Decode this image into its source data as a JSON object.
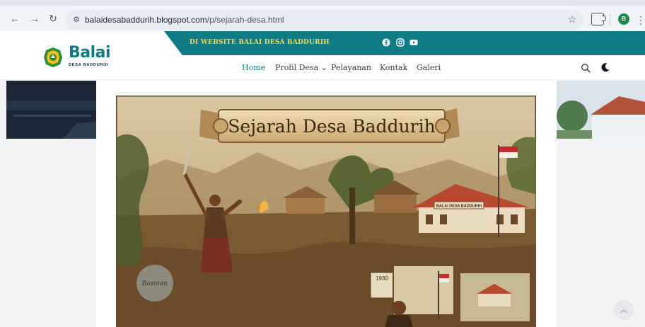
{
  "browser": {
    "back_icon": "arrow-left-icon",
    "forward_icon": "arrow-right-icon",
    "reload_icon": "reload-icon",
    "url_host": "balaidesabaddurih.blogspot.com",
    "url_path": "/p/sejarah-desa.html",
    "profile_initial": "B"
  },
  "site": {
    "marquee": "DI WEBSITE BALAI DESA BADDURIH",
    "logo_title": "Balai",
    "logo_subtitle": "DESA BADDURIH",
    "menu": [
      {
        "label": "Home",
        "active": true
      },
      {
        "label": "Profil Desa ⌄"
      },
      {
        "label": "Pelayanan"
      },
      {
        "label": "Kontak"
      },
      {
        "label": "Galeri"
      }
    ],
    "social_icons": [
      "facebook-icon",
      "instagram-icon",
      "youtube-icon"
    ]
  },
  "hero": {
    "banner_title": "Sejarah Desa Baddurih",
    "building_sign": "BALAI DESA BADDURIH",
    "stone_text": "Basman",
    "calendar_year": "1930"
  },
  "colors": {
    "teal": "#0f7b85",
    "marquee_yellow": "#ffd54a"
  }
}
